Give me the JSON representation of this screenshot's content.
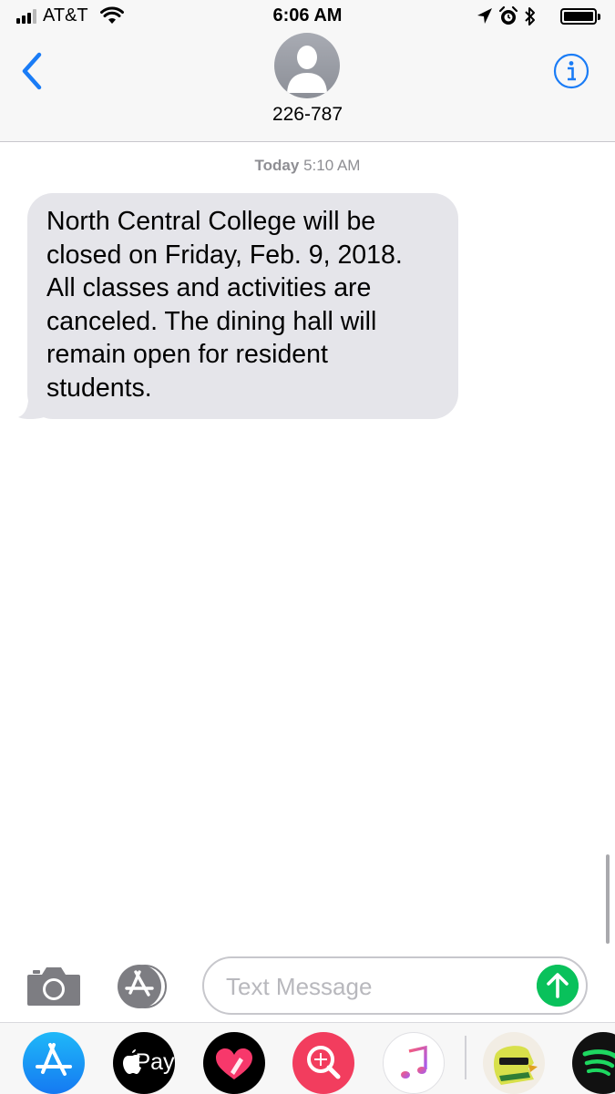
{
  "status_bar": {
    "carrier": "AT&T",
    "time": "6:06 AM",
    "icons": [
      "signal-icon",
      "wifi-icon",
      "location-arrow-icon",
      "alarm-clock-icon",
      "bluetooth-icon",
      "battery-icon"
    ]
  },
  "header": {
    "contact": "226-787",
    "back_icon": "chevron-left-icon",
    "info_icon": "info-icon",
    "accent_color": "#1a7cf6"
  },
  "conversation": {
    "timestamp_day": "Today",
    "timestamp_time": "5:10 AM",
    "messages": [
      {
        "direction": "incoming",
        "lines": [
          "North Central College will be",
          "closed on Friday, Feb. 9, 2018.",
          "All classes and activities are",
          "canceled. The dining hall will",
          "remain open for resident",
          "students."
        ]
      }
    ]
  },
  "composer": {
    "placeholder": "Text Message",
    "camera_icon": "camera-icon",
    "apps_icon": "app-store-icon",
    "send_icon": "send-arrow-icon",
    "send_color": "#09c15b"
  },
  "app_drawer": {
    "apps": [
      {
        "name": "app-store-icon"
      },
      {
        "name": "apple-pay-icon",
        "label": "Pay"
      },
      {
        "name": "digital-touch-heart-icon"
      },
      {
        "name": "images-search-icon"
      },
      {
        "name": "music-note-icon"
      },
      {
        "name": "sticker-app-icon"
      },
      {
        "name": "spotify-icon"
      }
    ]
  }
}
